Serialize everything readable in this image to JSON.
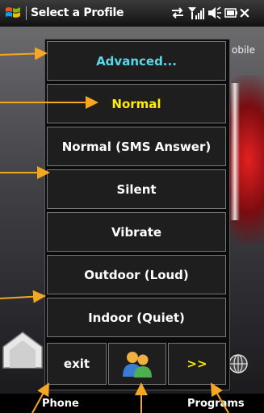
{
  "titlebar": {
    "title": "Select a Profile",
    "close_label": "×",
    "icons": [
      "windows-logo-icon",
      "connectivity-icon",
      "signal-icon",
      "volume-icon",
      "battery-icon"
    ]
  },
  "background": {
    "partial_text": "obile"
  },
  "softkeys": {
    "left": "Phone",
    "right": "Programs"
  },
  "profiles": {
    "items": [
      {
        "label": "Advanced...",
        "state": "advanced"
      },
      {
        "label": "Normal",
        "state": "selected"
      },
      {
        "label": "Normal (SMS Answer)",
        "state": "normal"
      },
      {
        "label": "Silent",
        "state": "normal"
      },
      {
        "label": "Vibrate",
        "state": "normal"
      },
      {
        "label": "Outdoor (Loud)",
        "state": "normal"
      },
      {
        "label": "Indoor (Quiet)",
        "state": "normal"
      }
    ],
    "exit_label": "exit",
    "more_label": ">>"
  },
  "colors": {
    "advanced_text": "#5ad7e8",
    "selected_text": "#ffee00",
    "arrow": "#f5a623"
  }
}
